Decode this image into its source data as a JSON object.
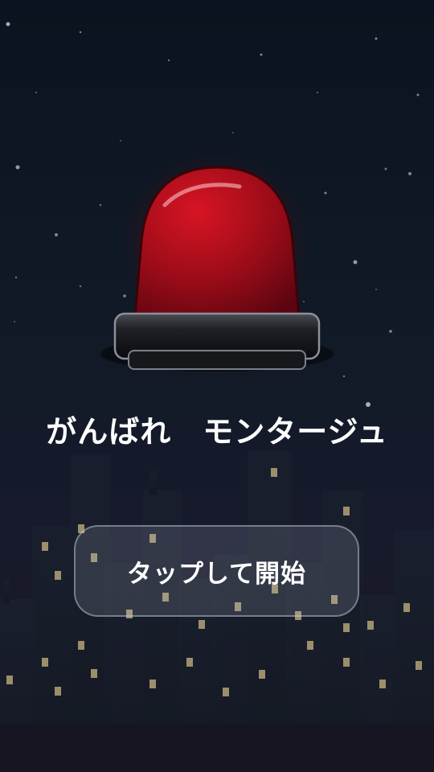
{
  "title": "がんばれ　モンタージュ",
  "start_button": {
    "label": "タップして開始"
  },
  "icons": {
    "siren": "red-siren-icon"
  },
  "colors": {
    "background_top": "#0b1320",
    "siren_red": "#b0101c",
    "window_light": "#c8b582",
    "text": "#ffffff"
  }
}
